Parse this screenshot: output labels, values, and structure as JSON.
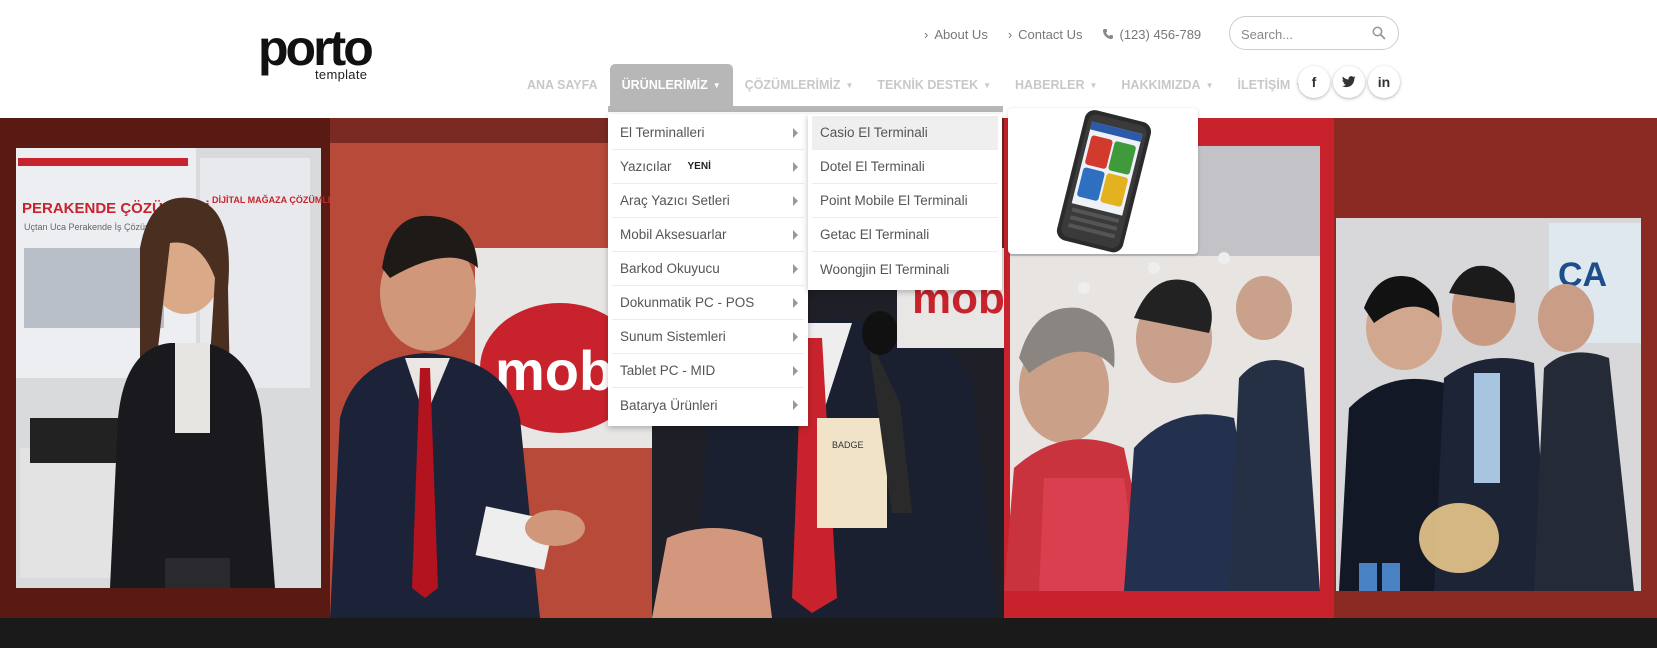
{
  "logo": {
    "word": "porto",
    "sub": "template"
  },
  "toplinks": [
    {
      "label": "About Us"
    },
    {
      "label": "Contact Us"
    },
    {
      "label": "(123) 456-789"
    }
  ],
  "search": {
    "placeholder": "Search..."
  },
  "nav": [
    {
      "label": "ANA SAYFA",
      "active": false,
      "caret": false
    },
    {
      "label": "ÜRÜNLERİMİZ",
      "active": true,
      "caret": true
    },
    {
      "label": "ÇÖZÜMLERİMİZ",
      "active": false,
      "caret": true
    },
    {
      "label": "TEKNİK DESTEK",
      "active": false,
      "caret": true
    },
    {
      "label": "HABERLER",
      "active": false,
      "caret": true
    },
    {
      "label": "HAKKIMIZDA",
      "active": false,
      "caret": true
    },
    {
      "label": "İLETİŞİM",
      "active": false,
      "caret": true
    }
  ],
  "social": [
    {
      "label": "f"
    },
    {
      "label": "t"
    },
    {
      "label": "in"
    }
  ],
  "dropdown": {
    "main": [
      {
        "label": "El Terminalleri",
        "tag": ""
      },
      {
        "label": "Yazıcılar",
        "tag": "YENİ"
      },
      {
        "label": "Araç Yazıcı Setleri",
        "tag": ""
      },
      {
        "label": "Mobil Aksesuarlar",
        "tag": ""
      },
      {
        "label": "Barkod Okuyucu",
        "tag": ""
      },
      {
        "label": "Dokunmatik PC - POS",
        "tag": ""
      },
      {
        "label": "Sunum Sistemleri",
        "tag": ""
      },
      {
        "label": "Tablet PC - MID",
        "tag": ""
      },
      {
        "label": "Batarya Ürünleri",
        "tag": ""
      }
    ],
    "sub": [
      {
        "label": "Casio El Terminali"
      },
      {
        "label": "Dotel El Terminali"
      },
      {
        "label": "Point Mobile El Terminali"
      },
      {
        "label": "Getac El Terminali"
      },
      {
        "label": "Woongjin El Terminali"
      }
    ]
  },
  "hero": {
    "banner_words": [
      "PERAKENDE ÇÖZÜMLERİ",
      "Uçtan Uca Perakende İş Çözümleri",
      "DİJİTAL MAĞAZA ÇÖZÜMLERİ",
      "mob",
      "mob",
      "CA"
    ]
  },
  "colors": {
    "nav_active": "#b7b7b7",
    "nav_text": "#c8c8c8",
    "brand_red": "#c8232c"
  }
}
